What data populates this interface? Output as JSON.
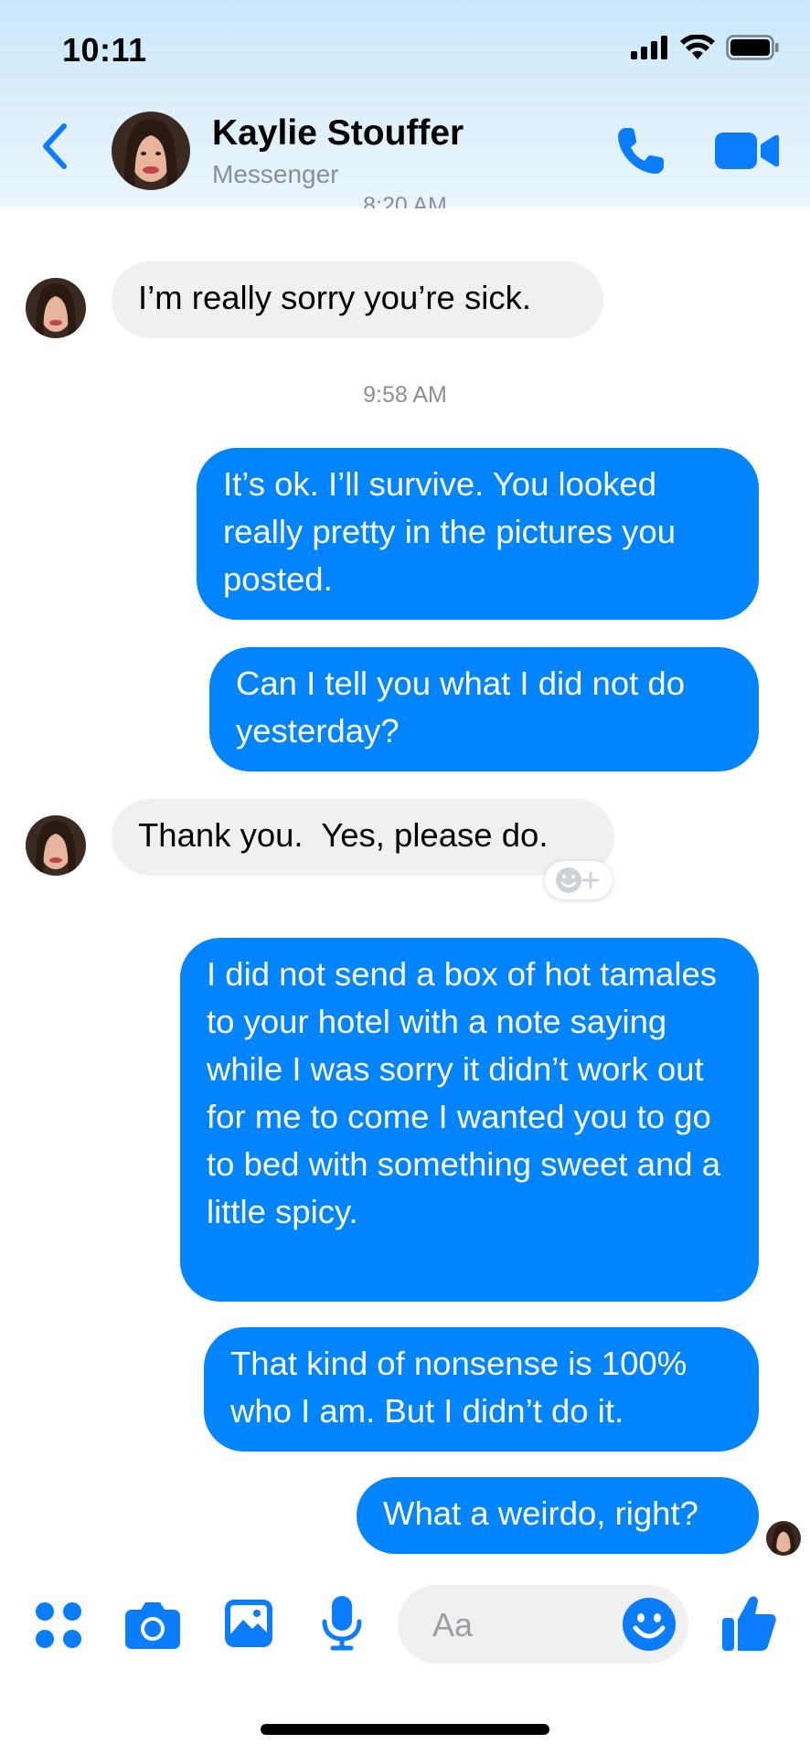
{
  "status_bar": {
    "time": "10:11"
  },
  "header": {
    "contact_name": "Kaylie Stouffer",
    "subtitle": "Messenger"
  },
  "conversation": {
    "top_timestamp": "8:20 AM",
    "messages": [
      {
        "direction": "incoming",
        "text": "I’m really sorry you’re sick."
      },
      {
        "timestamp": "9:58 AM"
      },
      {
        "direction": "outgoing",
        "text": "It’s ok. I’ll survive. You looked really pretty in the pictures you posted."
      },
      {
        "direction": "outgoing",
        "text": "Can I tell you what I did not do yesterday?"
      },
      {
        "direction": "incoming",
        "text": "Thank you.  Yes, please do."
      },
      {
        "direction": "outgoing",
        "text": "I did not send a box of hot tamales to your hotel with a note saying while I was sorry it didn’t work out for me to come I wanted you to go to bed with something sweet and a little spicy."
      },
      {
        "direction": "outgoing",
        "text": "That kind of nonsense is 100% who I am. But I didn’t do it."
      },
      {
        "direction": "outgoing",
        "text": "What a weirdo, right?"
      }
    ]
  },
  "composer": {
    "placeholder": "Aa"
  },
  "colors": {
    "accent": "#0084ff",
    "incoming_bubble": "#f0f0f0",
    "header_tint": "#d6ecfb"
  },
  "icons": [
    "back-chevron",
    "phone",
    "video-camera",
    "apps-grid",
    "camera",
    "image",
    "microphone",
    "smiley",
    "thumbs-up",
    "add-reaction"
  ]
}
